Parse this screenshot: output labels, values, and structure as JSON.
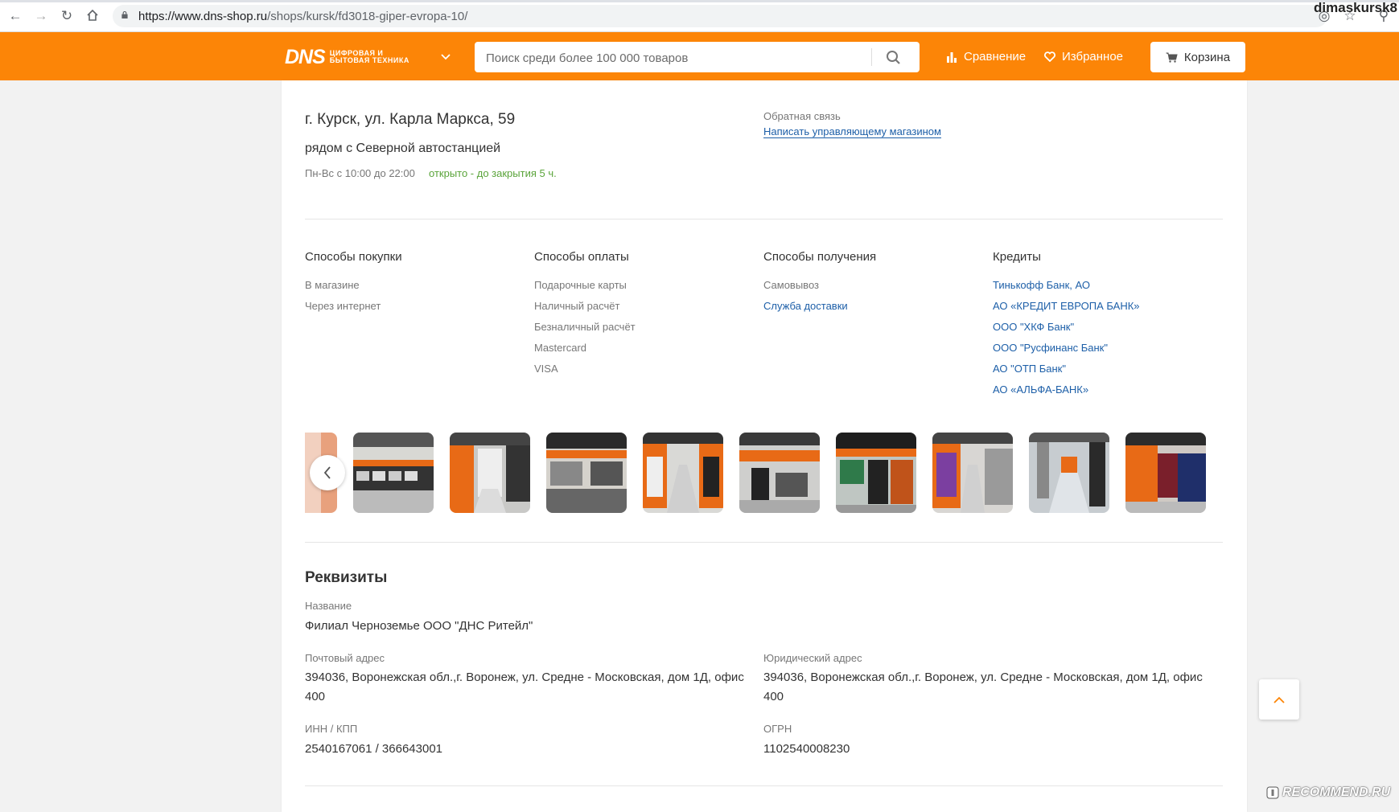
{
  "browser": {
    "url_host": "https://www.dns-shop.ru",
    "url_path": "/shops/kursk/fd3018-giper-evropa-10/",
    "user": "dimaskursk8"
  },
  "header": {
    "logo_text": "DNS",
    "logo_sub_1": "ЦИФРОВАЯ И",
    "logo_sub_2": "БЫТОВАЯ ТЕХНИКА",
    "search_placeholder": "Поиск среди более 100 000 товаров",
    "compare_label": "Сравнение",
    "favorites_label": "Избранное",
    "cart_label": "Корзина",
    "accent_color": "#fc8507"
  },
  "shop": {
    "address": "г. Курск, ул. Карла Маркса, 59",
    "landmark": "рядом с Северной автостанцией",
    "hours": "Пн-Вс с 10:00 до 22:00",
    "status": "открыто - до закрытия 5 ч.",
    "feedback_label": "Обратная связь",
    "feedback_link": "Написать управляющему магазином"
  },
  "columns": [
    {
      "title": "Способы покупки",
      "items": [
        "В магазине",
        "Через интернет"
      ]
    },
    {
      "title": "Способы оплаты",
      "items": [
        "Подарочные карты",
        "Наличный расчёт",
        "Безналичный расчёт",
        "Mastercard",
        "VISA"
      ]
    },
    {
      "title": "Способы получения",
      "items": [
        "Самовывоз"
      ],
      "links": [
        "Служба доставки"
      ]
    },
    {
      "title": "Кредиты",
      "links": [
        "Тинькофф Банк, АО",
        "АО «КРЕДИТ ЕВРОПА БАНК»",
        "ООО \"ХКФ Банк\"",
        "ООО \"Русфинанс Банк\"",
        "АО \"ОТП Банк\"",
        "АО «АЛЬФА-БАНК»"
      ]
    }
  ],
  "requisites": {
    "title": "Реквизиты",
    "name_label": "Название",
    "name_value": "Филиал Черноземье ООО \"ДНС Ритейл\"",
    "postal_label": "Почтовый адрес",
    "postal_value": "394036, Воронежская обл.,г. Воронеж, ул. Средне - Московская, дом 1Д, офис 400",
    "legal_label": "Юридический адрес",
    "legal_value": "394036, Воронежская обл.,г. Воронеж, ул. Средне - Московская, дом 1Д, офис 400",
    "inn_label": "ИНН / КПП",
    "inn_value": "2540167061 / 366643001",
    "ogrn_label": "ОГРН",
    "ogrn_value": "1102540008230"
  },
  "watermark": "RECOMMEND.RU"
}
